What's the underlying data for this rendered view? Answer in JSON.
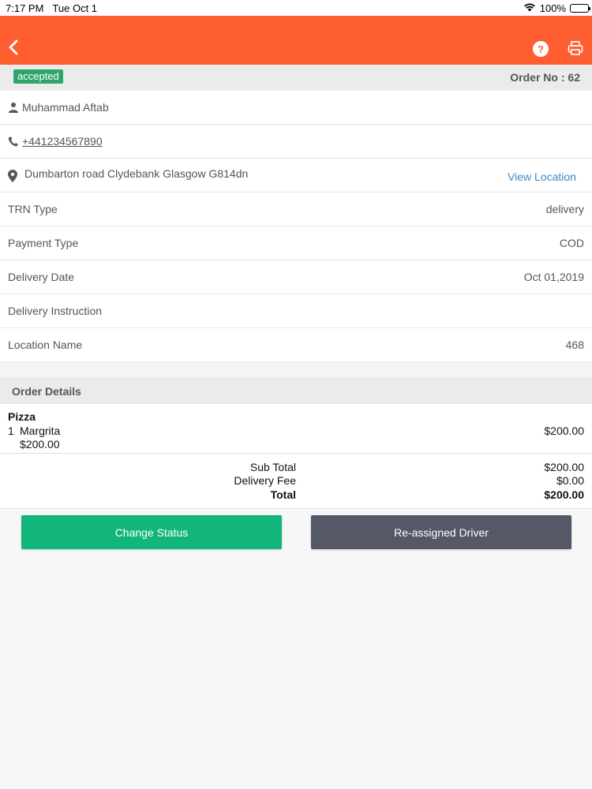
{
  "status_bar": {
    "time": "7:17 PM",
    "date": "Tue Oct 1",
    "battery": "100%"
  },
  "colors": {
    "accent": "#ff5e31",
    "badge": "#2fa56e",
    "primary_button": "#12b67b",
    "secondary_button": "#555967",
    "link": "#3b87c8"
  },
  "navbar": {
    "icons": [
      "back-chevron-icon",
      "help-icon",
      "print-icon"
    ]
  },
  "order": {
    "status": "accepted",
    "order_no_label": "Order No : 62"
  },
  "customer": {
    "name": "Muhammad Aftab",
    "phone": "+441234567890",
    "address": "Dumbarton road Clydebank Glasgow G814dn",
    "view_location": "View Location"
  },
  "details": [
    {
      "label": "TRN Type",
      "value": "delivery"
    },
    {
      "label": "Payment Type",
      "value": "COD"
    },
    {
      "label": "Delivery Date",
      "value": "Oct 01,2019"
    },
    {
      "label": "Delivery Instruction",
      "value": ""
    },
    {
      "label": "Location Name",
      "value": "468"
    }
  ],
  "order_details": {
    "title": "Order Details",
    "category": "Pizza",
    "items": [
      {
        "qty": "1",
        "name": "Margrita",
        "price": "$200.00",
        "unit_price": "$200.00"
      }
    ]
  },
  "totals": {
    "sub_total_label": "Sub Total",
    "sub_total": "$200.00",
    "delivery_fee_label": "Delivery Fee",
    "delivery_fee": "$0.00",
    "total_label": "Total",
    "total": "$200.00"
  },
  "actions": {
    "change_status": "Change Status",
    "reassign": "Re-assigned Driver"
  }
}
